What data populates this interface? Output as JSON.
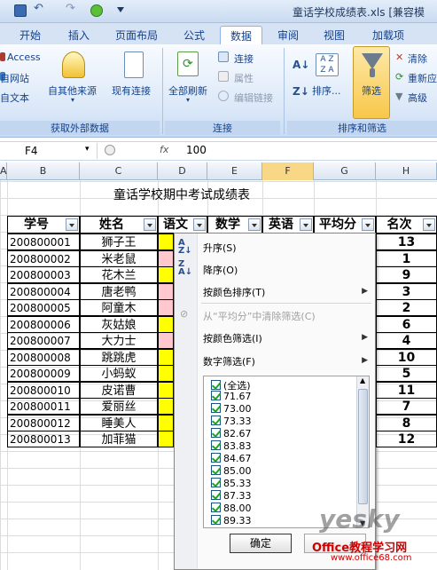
{
  "window": {
    "title": "童话学校成绩表.xls [兼容模"
  },
  "tabs": [
    "开始",
    "插入",
    "页面布局",
    "公式",
    "数据",
    "审阅",
    "视图",
    "加载项"
  ],
  "ribbon": {
    "ext": {
      "access": "Access",
      "web": "自网站",
      "text": "自文本",
      "other": "自其他来源",
      "existing": "现有连接",
      "label": "获取外部数据"
    },
    "conn": {
      "refresh": "全部刷新",
      "connections": "连接",
      "properties": "属性",
      "edit_links": "编辑链接",
      "label": "连接"
    },
    "sort": {
      "sort": "排序...",
      "filter": "筛选",
      "clear": "清除",
      "reapply": "重新应",
      "advanced": "高级",
      "label": "排序和筛选"
    }
  },
  "formula_bar": {
    "cell_ref": "F4",
    "fx": "fx",
    "value": "100"
  },
  "columns": [
    "A",
    "B",
    "C",
    "D",
    "E",
    "F",
    "G",
    "H"
  ],
  "sheet": {
    "title": "童话学校期中考试成绩表",
    "headers": [
      "学号",
      "姓名",
      "语文",
      "数学",
      "英语",
      "平均分",
      "名次"
    ],
    "rows": [
      {
        "id": "200800001",
        "name": "狮子王",
        "rank": "13"
      },
      {
        "id": "200800002",
        "name": "米老鼠",
        "rank": "1"
      },
      {
        "id": "200800003",
        "name": "花木兰",
        "rank": "9"
      },
      {
        "id": "200800004",
        "name": "唐老鸭",
        "rank": "3"
      },
      {
        "id": "200800005",
        "name": "阿童木",
        "rank": "2"
      },
      {
        "id": "200800006",
        "name": "灰姑娘",
        "rank": "6"
      },
      {
        "id": "200800007",
        "name": "大力士",
        "rank": "4"
      },
      {
        "id": "200800008",
        "name": "跳跳虎",
        "rank": "10"
      },
      {
        "id": "200800009",
        "name": "小蚂蚁",
        "rank": "5"
      },
      {
        "id": "200800010",
        "name": "皮诺曹",
        "rank": "11"
      },
      {
        "id": "200800011",
        "name": "爱丽丝",
        "rank": "7"
      },
      {
        "id": "200800012",
        "name": "睡美人",
        "rank": "8"
      },
      {
        "id": "200800013",
        "name": "加菲猫",
        "rank": "12"
      }
    ],
    "fill_colors": [
      "#ffff00",
      "#ffc7ce",
      "#ffff00",
      "#ffc7ce",
      "#ffc7ce",
      "#ffff00",
      "#ffc7ce",
      "#ffff00",
      "#ffff00",
      "#ffff00",
      "#ffff00",
      "#ffff00",
      "#ffff00"
    ]
  },
  "dropdown": {
    "sort_asc": "升序(S)",
    "sort_desc": "降序(O)",
    "sort_by_color": "按颜色排序(T)",
    "clear_filter": "从“平均分”中清除筛选(C)",
    "filter_by_color": "按颜色筛选(I)",
    "number_filter": "数字筛选(F)",
    "list": [
      "(全选)",
      "71.67",
      "73.00",
      "73.33",
      "82.67",
      "83.83",
      "84.67",
      "85.00",
      "85.33",
      "87.33",
      "88.00",
      "89.33"
    ],
    "ok": "确定"
  },
  "watermark": {
    "brand": "yesky",
    "site": "Office教程学习网",
    "url": "www.office68.com"
  }
}
